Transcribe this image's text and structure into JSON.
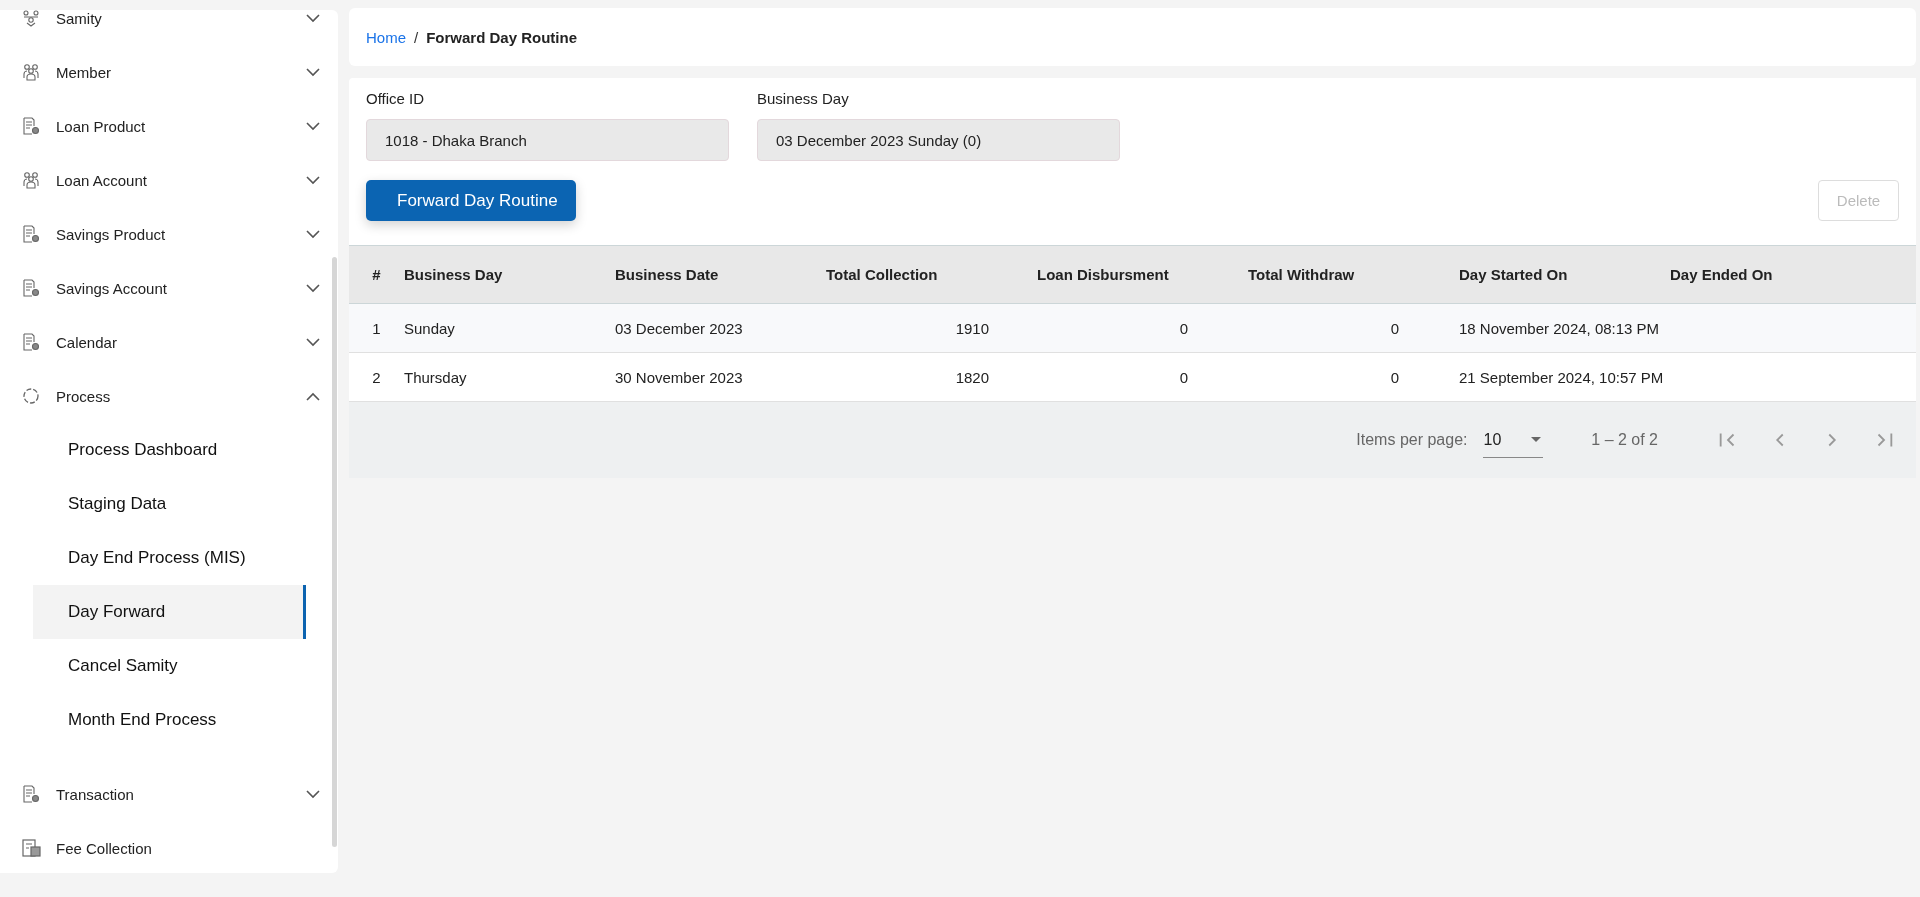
{
  "sidebar": {
    "items": [
      {
        "label": "Samity",
        "expanded": false
      },
      {
        "label": "Member",
        "expanded": false
      },
      {
        "label": "Loan Product",
        "expanded": false
      },
      {
        "label": "Loan Account",
        "expanded": false
      },
      {
        "label": "Savings Product",
        "expanded": false
      },
      {
        "label": "Savings Account",
        "expanded": false
      },
      {
        "label": "Calendar",
        "expanded": false
      },
      {
        "label": "Process",
        "expanded": true,
        "children": [
          {
            "label": "Process Dashboard",
            "selected": false
          },
          {
            "label": "Staging Data",
            "selected": false
          },
          {
            "label": "Day End Process (MIS)",
            "selected": false
          },
          {
            "label": "Day Forward",
            "selected": true
          },
          {
            "label": "Cancel Samity",
            "selected": false
          },
          {
            "label": "Month End Process",
            "selected": false
          }
        ]
      },
      {
        "label": "Transaction",
        "expanded": false
      },
      {
        "label": "Fee Collection"
      }
    ]
  },
  "breadcrumb": {
    "link": "Home",
    "separator": "/",
    "current": "Forward Day Routine"
  },
  "form": {
    "fields": [
      {
        "label": "Office ID",
        "value": "1018 - Dhaka Branch"
      },
      {
        "label": "Business Day",
        "value": "03 December 2023 Sunday (0)"
      }
    ],
    "primary_button": "Forward Day Routine",
    "delete_button": {
      "label": "Delete",
      "disabled": true
    }
  },
  "table": {
    "columns": [
      "#",
      "Business Day",
      "Business Date",
      "Total Collection",
      "Loan Disbursment",
      "Total Withdraw",
      "Day Started On",
      "Day Ended On"
    ],
    "rows": [
      [
        "1",
        "Sunday",
        "03 December 2023",
        "1910",
        "0",
        "0",
        "18 November 2024, 08:13 PM",
        ""
      ],
      [
        "2",
        "Thursday",
        "30 November 2023",
        "1820",
        "0",
        "0",
        "21 September 2024, 10:57 PM",
        ""
      ]
    ]
  },
  "paginator": {
    "label": "Items per page:",
    "page_size": "10",
    "range": "1 – 2 of 2"
  }
}
